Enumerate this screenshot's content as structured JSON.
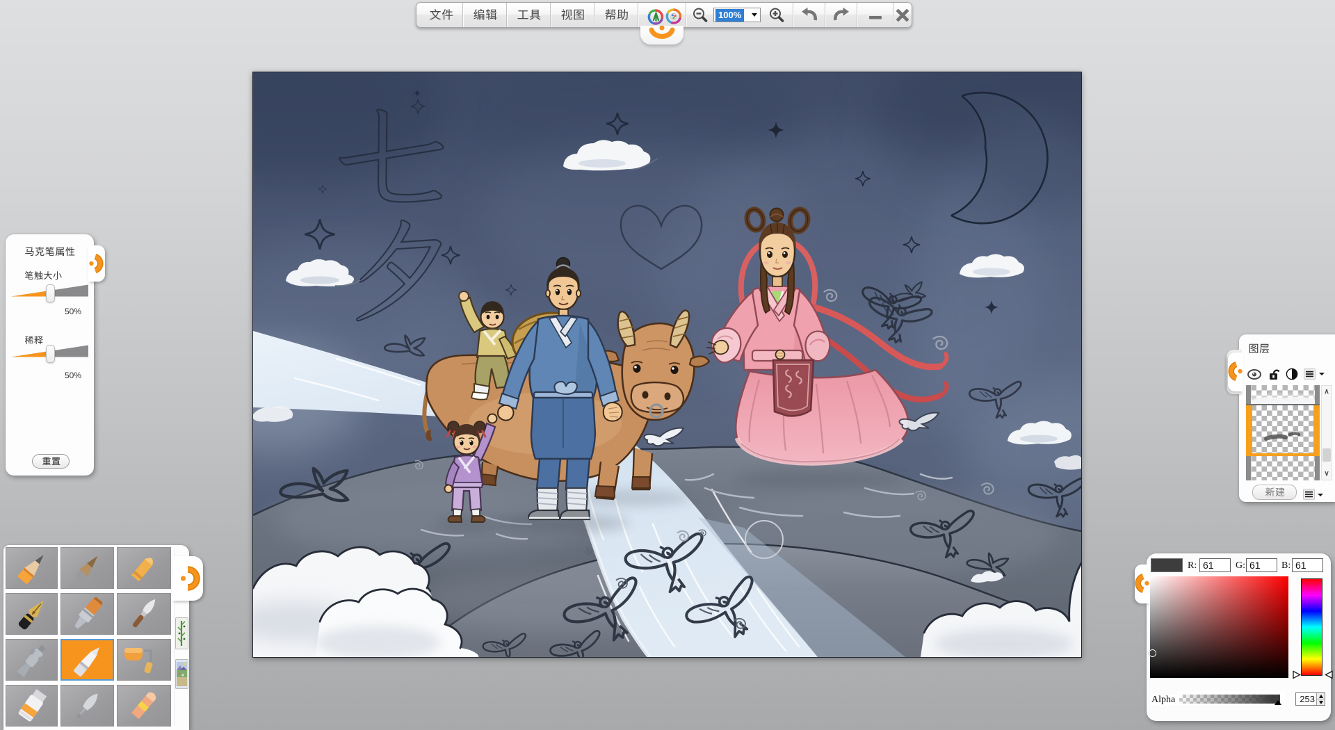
{
  "app": {
    "name": "paint-application",
    "accent_orange": "#f7941d"
  },
  "toolbar": {
    "menus": [
      {
        "label": "文件"
      },
      {
        "label": "编辑"
      },
      {
        "label": "工具"
      },
      {
        "label": "视图"
      },
      {
        "label": "帮助"
      }
    ],
    "zoom": {
      "value": "100%"
    },
    "actions": {
      "zoom_out": "zoom-out",
      "zoom_in": "zoom-in",
      "undo": "undo",
      "redo": "redo",
      "minimize": "minimize",
      "close": "close"
    }
  },
  "marker_panel": {
    "title": "马克笔属性",
    "sliders": [
      {
        "label": "笔触大小",
        "value": "50%",
        "percent": 50
      },
      {
        "label": "稀释",
        "value": "50%",
        "percent": 50
      }
    ],
    "reset_label": "重置"
  },
  "tool_palette": {
    "tools": [
      {
        "name": "pencil",
        "selected": false
      },
      {
        "name": "charcoal-stick",
        "selected": false
      },
      {
        "name": "crayon",
        "selected": false
      },
      {
        "name": "fountain-pen",
        "selected": false
      },
      {
        "name": "flat-brush",
        "selected": false
      },
      {
        "name": "ink-brush",
        "selected": false
      },
      {
        "name": "airbrush",
        "selected": false
      },
      {
        "name": "marker",
        "selected": true
      },
      {
        "name": "paint-roller",
        "selected": false
      },
      {
        "name": "paint-tube",
        "selected": false
      },
      {
        "name": "quill-brush",
        "selected": false
      },
      {
        "name": "eraser",
        "selected": false
      }
    ],
    "side_tabs": [
      {
        "name": "bamboo-brush-set"
      },
      {
        "name": "picture-tool-set"
      }
    ]
  },
  "layers_panel": {
    "title": "图层",
    "icons": [
      "visibility",
      "lock-open",
      "contrast",
      "list-menu",
      "dropdown"
    ],
    "layers": [
      {
        "content": "clouds",
        "selected": false
      },
      {
        "content": "gray-strokes",
        "selected": true
      },
      {
        "content": "empty",
        "selected": false
      }
    ],
    "new_button_label": "新建"
  },
  "color_panel": {
    "swatch_color": "#3d3d3d",
    "channels": [
      {
        "label": "R:",
        "value": "61"
      },
      {
        "label": "G:",
        "value": "61"
      },
      {
        "label": "B:",
        "value": "61"
      }
    ],
    "alpha_label": "Alpha",
    "alpha_value": "253"
  },
  "canvas": {
    "zoom_level": "100%",
    "sketch_characters": [
      "七",
      "夕"
    ]
  }
}
